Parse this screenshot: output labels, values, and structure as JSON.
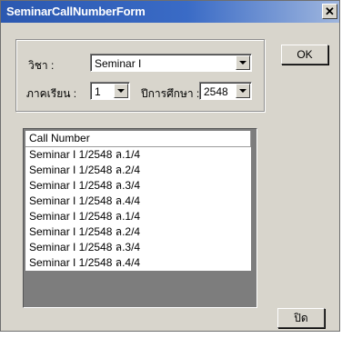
{
  "window": {
    "title": "SeminarCallNumberForm",
    "close_glyph": "✕"
  },
  "form": {
    "subject_label": "วิชา :",
    "subject_value": "Seminar I",
    "semester_label": "ภาคเรียน :",
    "semester_value": "1",
    "year_label": "ปีการศึกษา :",
    "year_value": "2548"
  },
  "buttons": {
    "ok_label": "OK",
    "close_label": "ปิด"
  },
  "list": {
    "column_header": "Call Number",
    "rows": [
      "Seminar I 1/2548 ล.1/4",
      "Seminar I 1/2548 ล.2/4",
      "Seminar I 1/2548 ล.3/4",
      "Seminar I 1/2548 ล.4/4",
      "Seminar I 1/2548 ล.1/4",
      "Seminar I 1/2548 ล.2/4",
      "Seminar I 1/2548 ล.3/4",
      "Seminar I 1/2548 ล.4/4"
    ]
  },
  "icons": {
    "dropdown": "chevron-down-icon",
    "close": "close-icon"
  }
}
